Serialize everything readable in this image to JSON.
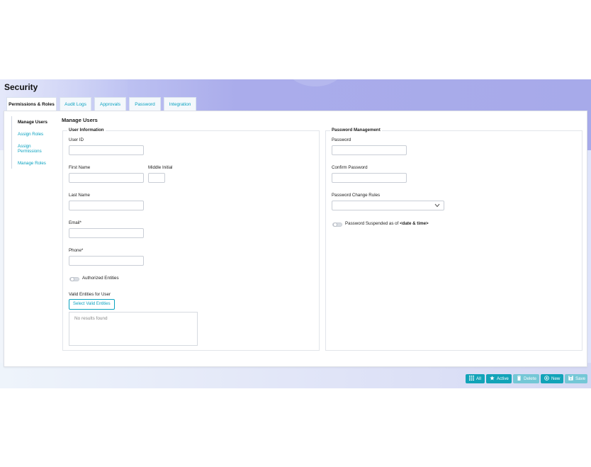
{
  "page": {
    "title": "Security"
  },
  "tabs": [
    {
      "label": "Permissions & Roles",
      "active": true
    },
    {
      "label": "Audit Logs",
      "active": false
    },
    {
      "label": "Approvals",
      "active": false
    },
    {
      "label": "Password",
      "active": false
    },
    {
      "label": "Integration",
      "active": false
    }
  ],
  "sidebar": {
    "items": [
      {
        "label": "Manage Users",
        "active": true
      },
      {
        "label": "Assign Roles",
        "active": false
      },
      {
        "label": "Assign Permissions",
        "active": false
      },
      {
        "label": "Manage Roles",
        "active": false
      }
    ]
  },
  "main": {
    "section_title": "Manage Users",
    "user_info": {
      "legend": "User Information",
      "user_id_label": "User ID",
      "first_name_label": "First Name",
      "middle_initial_label": "Middle Initial",
      "last_name_label": "Last Name",
      "email_label": "Email*",
      "phone_label": "Phone*",
      "authorized_entities_label": "Authorized Entities",
      "valid_entities_label": "Valid Entities for User",
      "select_valid_entities_button": "Select Valid Entities",
      "no_results_text": "No results found"
    },
    "password_mgmt": {
      "legend": "Password Management",
      "password_label": "Password",
      "confirm_password_label": "Confirm Password",
      "change_rules_label": "Password Change Rules",
      "suspended_label_prefix": "Password Suspended as of ",
      "suspended_label_value": "<date & time>"
    }
  },
  "actions": {
    "all": "All",
    "active": "Active",
    "delete": "Delete",
    "new": "New",
    "save": "Save"
  },
  "icons": {
    "all": "grid-icon",
    "active": "star-icon",
    "delete": "trash-icon",
    "new": "plus-circle-icon",
    "save": "floppy-icon",
    "dropdown": "chevron-down-icon"
  },
  "colors": {
    "accent": "#0aa2c0",
    "button": "#12a3b8",
    "button_disabled": "#74c7d6",
    "hero": "#a7aaea"
  }
}
